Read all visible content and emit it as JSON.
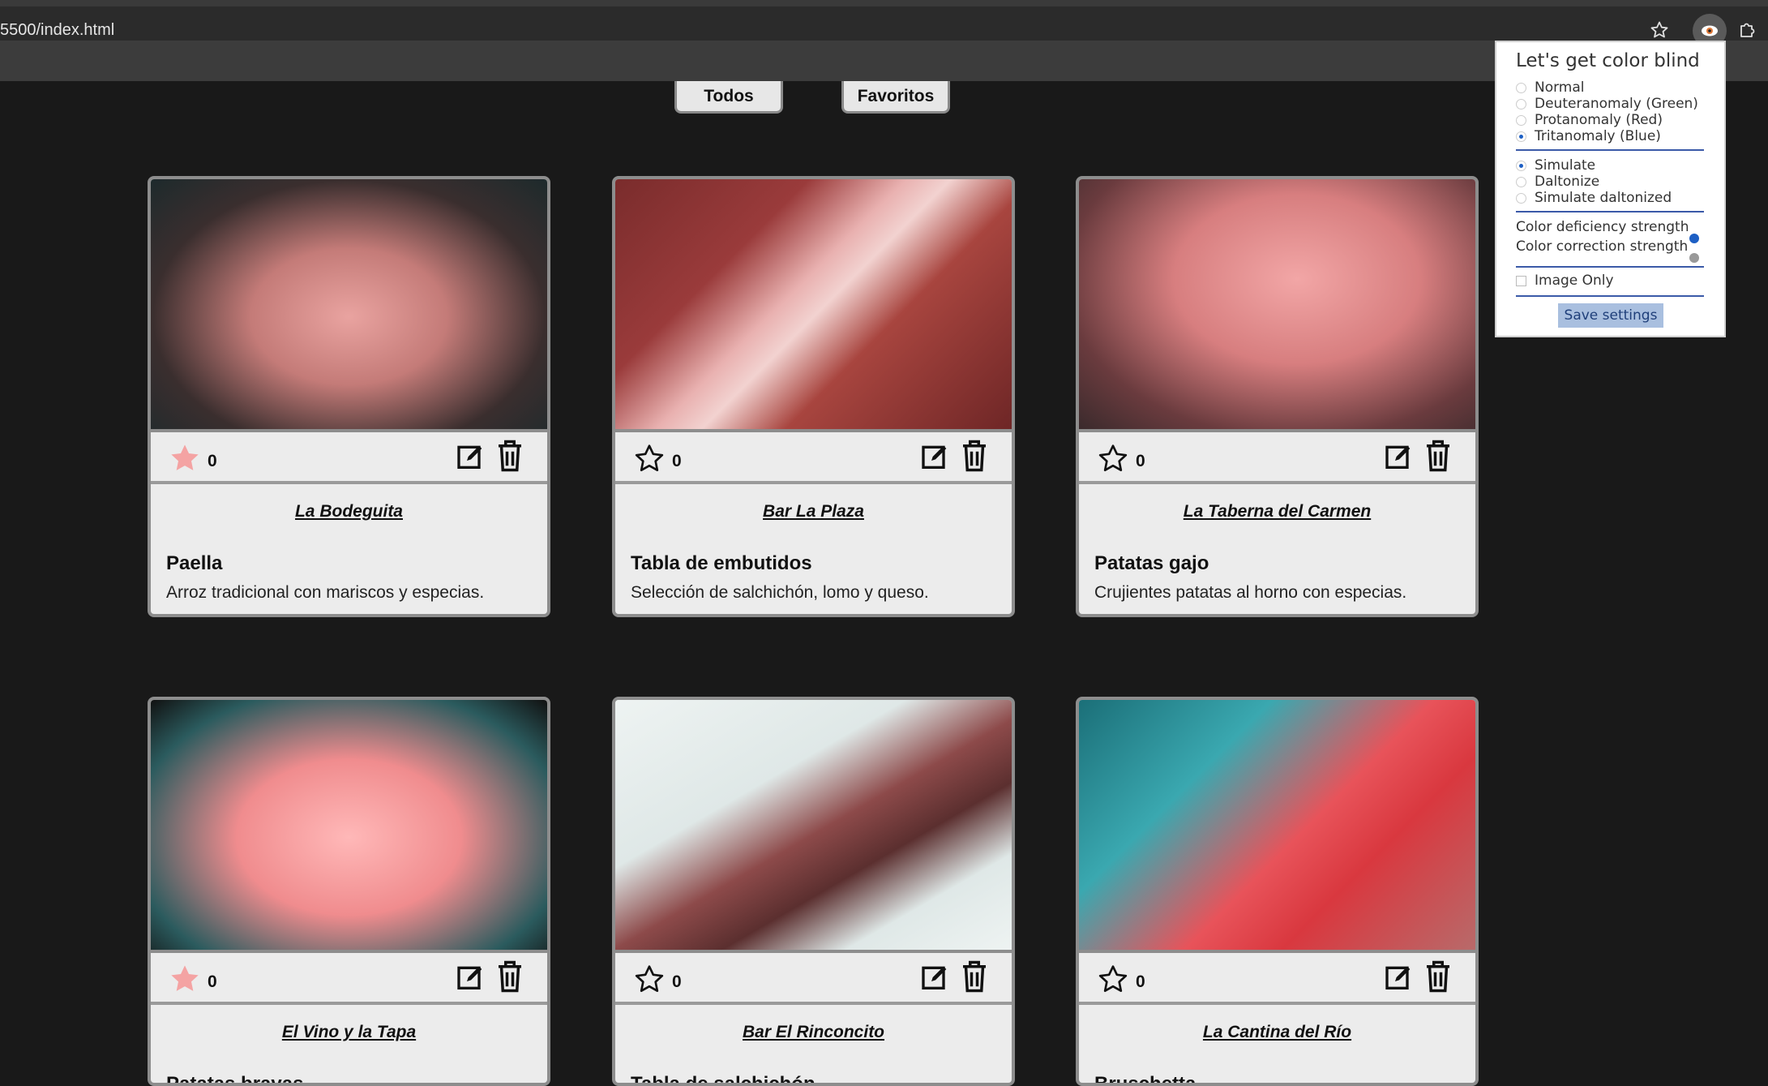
{
  "browser": {
    "url": "5500/index.html",
    "bookmark_icon": "star-outline-icon",
    "extension_icon": "eye-icon",
    "extensions_menu_icon": "puzzle-icon"
  },
  "filters": {
    "all_label": "Todos",
    "favorites_label": "Favoritos"
  },
  "cards": [
    {
      "restaurant": "La Bodeguita",
      "dish": "Paella",
      "description": "Arroz tradicional con mariscos y especias.",
      "favorite": true,
      "likes": "0",
      "image": "paella-photo"
    },
    {
      "restaurant": "Bar La Plaza",
      "dish": "Tabla de embutidos",
      "description": "Selección de salchichón, lomo y queso.",
      "favorite": false,
      "likes": "0",
      "image": "charcuterie-board-photo"
    },
    {
      "restaurant": "La Taberna del Carmen",
      "dish": "Patatas gajo",
      "description": "Crujientes patatas al horno con especias.",
      "favorite": false,
      "likes": "0",
      "image": "potato-wedges-photo"
    },
    {
      "restaurant": "El Vino y la Tapa",
      "dish": "Patatas bravas",
      "description": "",
      "favorite": true,
      "likes": "0",
      "image": "patatas-bravas-photo"
    },
    {
      "restaurant": "Bar El Rinconcito",
      "dish": "Tabla de salchichón",
      "description": "",
      "favorite": false,
      "likes": "0",
      "image": "salami-board-photo"
    },
    {
      "restaurant": "La Cantina del Río",
      "dish": "Bruschetta",
      "description": "",
      "favorite": false,
      "likes": "0",
      "image": "bruschetta-photo"
    }
  ],
  "colorblind_popup": {
    "title": "Let's get color blind",
    "modes": [
      {
        "label": "Normal",
        "selected": false
      },
      {
        "label": "Deuteranomaly (Green)",
        "selected": false
      },
      {
        "label": "Protanomaly (Red)",
        "selected": false
      },
      {
        "label": "Tritanomaly (Blue)",
        "selected": true
      }
    ],
    "actions": [
      {
        "label": "Simulate",
        "selected": true
      },
      {
        "label": "Daltonize",
        "selected": false
      },
      {
        "label": "Simulate daltonized",
        "selected": false
      }
    ],
    "deficiency_label": "Color deficiency strength",
    "deficiency_value": 0.95,
    "correction_label": "Color correction strength",
    "correction_value": 0.95,
    "image_only_label": "Image Only",
    "image_only_checked": false,
    "save_label": "Save settings"
  },
  "colors": {
    "page_background": "#191919",
    "card_background": "#ececec",
    "favorite_star": "#f4a3a3",
    "popup_accent": "#3b5aa8"
  }
}
